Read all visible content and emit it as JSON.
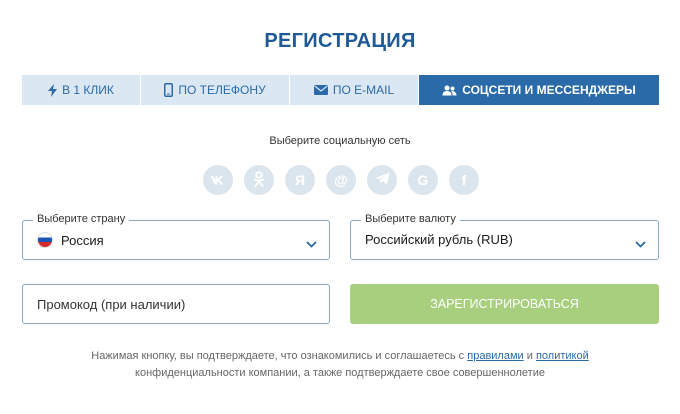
{
  "title": "РЕГИСТРАЦИЯ",
  "tabs": [
    {
      "label": "В 1 КЛИК",
      "icon": "lightning-icon"
    },
    {
      "label": "ПО ТЕЛЕФОНУ",
      "icon": "phone-icon"
    },
    {
      "label": "ПО E-MAIL",
      "icon": "envelope-icon"
    },
    {
      "label": "СОЦСЕТИ И МЕССЕНДЖЕРЫ",
      "icon": "users-icon",
      "active": true
    }
  ],
  "social": {
    "label": "Выберите социальную сеть",
    "networks": [
      {
        "name": "vk",
        "glyph": "vk"
      },
      {
        "name": "odnoklassniki",
        "glyph": "ok"
      },
      {
        "name": "yandex",
        "glyph": "Я"
      },
      {
        "name": "mail",
        "glyph": "@"
      },
      {
        "name": "telegram",
        "glyph": "tg"
      },
      {
        "name": "google",
        "glyph": "G"
      },
      {
        "name": "facebook",
        "glyph": "f"
      }
    ]
  },
  "country": {
    "label": "Выберите страну",
    "value": "Россия"
  },
  "currency": {
    "label": "Выберите валюту",
    "value": "Российский рубль (RUB)"
  },
  "promo": {
    "placeholder": "Промокод (при наличии)",
    "value": ""
  },
  "register": {
    "label": "ЗАРЕГИСТРИРОВАТЬСЯ"
  },
  "terms": {
    "line1_start": "Нажимая кнопку, вы подтверждаете, что ознакомились и соглашаетесь с ",
    "rules_link": "правилами",
    "and": " и ",
    "policy_link": "политикой",
    "line2": "конфиденциальности компании, а также подтверждаете свое совершеннолетие"
  },
  "colors": {
    "accent": "#2a6aa8",
    "title": "#1f5a96",
    "tab_inactive_bg": "#dbe8f4",
    "register_bg": "#a8cf7d",
    "social_bg": "#dbe5ee"
  }
}
